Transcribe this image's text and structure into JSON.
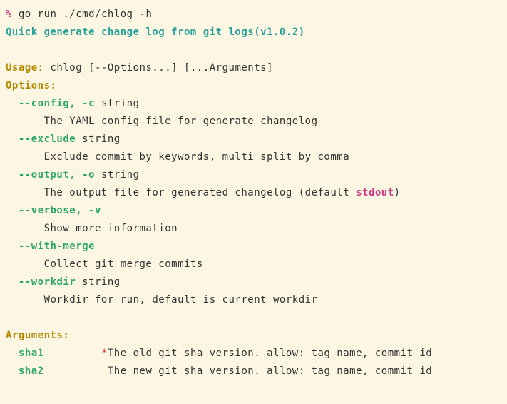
{
  "prompt": {
    "symbol": "%",
    "command": " go run ./cmd/chlog -h"
  },
  "headline": "Quick generate change log from git logs(v1.0.2)",
  "usage": {
    "label": "Usage:",
    "text": " chlog [--Options...] [...Arguments]"
  },
  "options_label": "Options:",
  "options": {
    "config": {
      "flags": "  --config, -c",
      "type": " string",
      "desc": "      The YAML config file for generate changelog"
    },
    "exclude": {
      "flags": "  --exclude",
      "type": " string",
      "desc": "      Exclude commit by keywords, multi split by comma"
    },
    "output": {
      "flags": "  --output, -o",
      "type": " string",
      "desc1": "      The output file for generated changelog (default ",
      "default": "stdout",
      "desc2": ")"
    },
    "verbose": {
      "flags": "  --verbose, -v",
      "type": "",
      "desc": "      Show more information"
    },
    "withmerge": {
      "flags": "  --with-merge",
      "type": "",
      "desc": "      Collect git merge commits"
    },
    "workdir": {
      "flags": "  --workdir",
      "type": " string",
      "desc": "      Workdir for run, default is current workdir"
    }
  },
  "arguments_label": "Arguments:",
  "arguments": {
    "sha1": {
      "name": "  sha1",
      "pad": "         ",
      "req": "*",
      "desc": "The old git sha version. allow: tag name, commit id"
    },
    "sha2": {
      "name": "  sha2",
      "pad": "          ",
      "desc": "The new git sha version. allow: tag name, commit id"
    }
  }
}
